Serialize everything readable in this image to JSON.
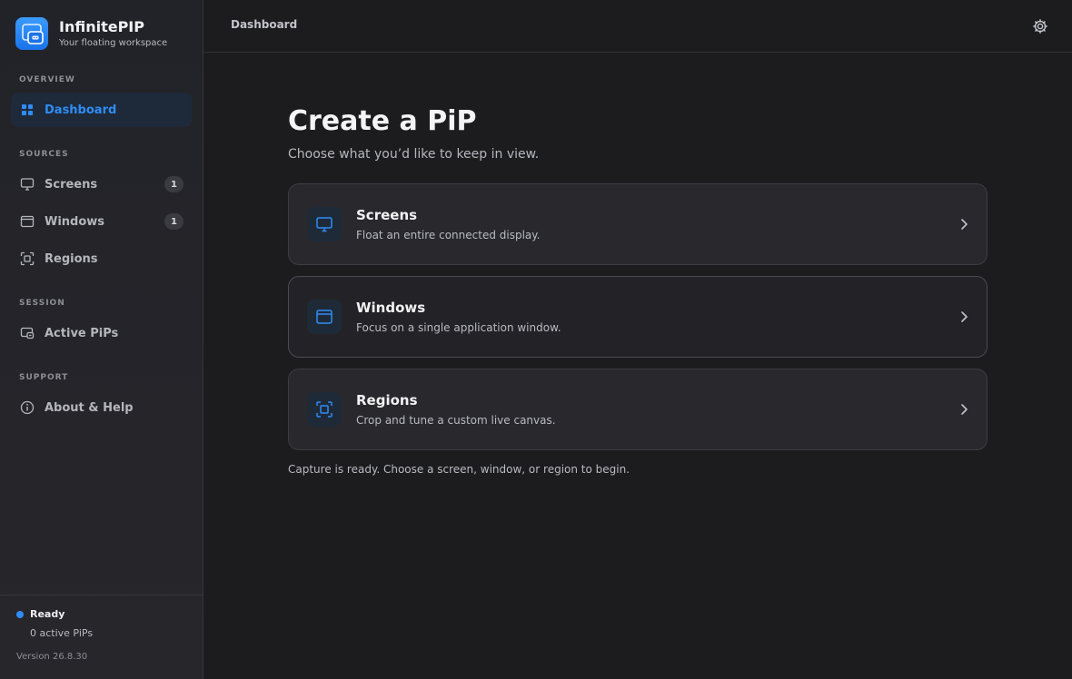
{
  "brand": {
    "name": "InfinitePIP",
    "tagline": "Your floating workspace",
    "logo_icon": "infinity-pip-icon"
  },
  "sidebar": {
    "sections": [
      {
        "label": "OVERVIEW"
      },
      {
        "label": "SOURCES"
      },
      {
        "label": "SESSION"
      },
      {
        "label": "SUPPORT"
      }
    ],
    "items": [
      {
        "label": "Dashboard",
        "icon": "grid-icon",
        "active": true
      },
      {
        "label": "Screens",
        "icon": "monitor-icon",
        "count": "1"
      },
      {
        "label": "Windows",
        "icon": "window-icon",
        "count": "1"
      },
      {
        "label": "Regions",
        "icon": "region-icon"
      },
      {
        "label": "Active PiPs",
        "icon": "pip-icon"
      },
      {
        "label": "About & Help",
        "icon": "info-icon"
      }
    ],
    "footer": {
      "status": "Ready",
      "active_pips": "0 active PiPs",
      "version": "Version 26.8.30"
    }
  },
  "topbar": {
    "breadcrumb": "Dashboard",
    "settings_icon": "gear-icon"
  },
  "main": {
    "title": "Create a PiP",
    "subtitle": "Choose what you’d like to keep in view.",
    "cards": [
      {
        "title": "Screens",
        "description": "Float an entire connected display.",
        "icon": "monitor-icon"
      },
      {
        "title": "Windows",
        "description": "Focus on a single application window.",
        "icon": "window-icon"
      },
      {
        "title": "Regions",
        "description": "Crop and tune a custom live canvas.",
        "icon": "region-icon"
      }
    ],
    "capture_note": "Capture is ready. Choose a screen, window, or region to begin."
  },
  "colors": {
    "accent": "#2f8cf5",
    "background": "#1c1c1f",
    "sidebar": "#222328",
    "card": "#28282d"
  }
}
